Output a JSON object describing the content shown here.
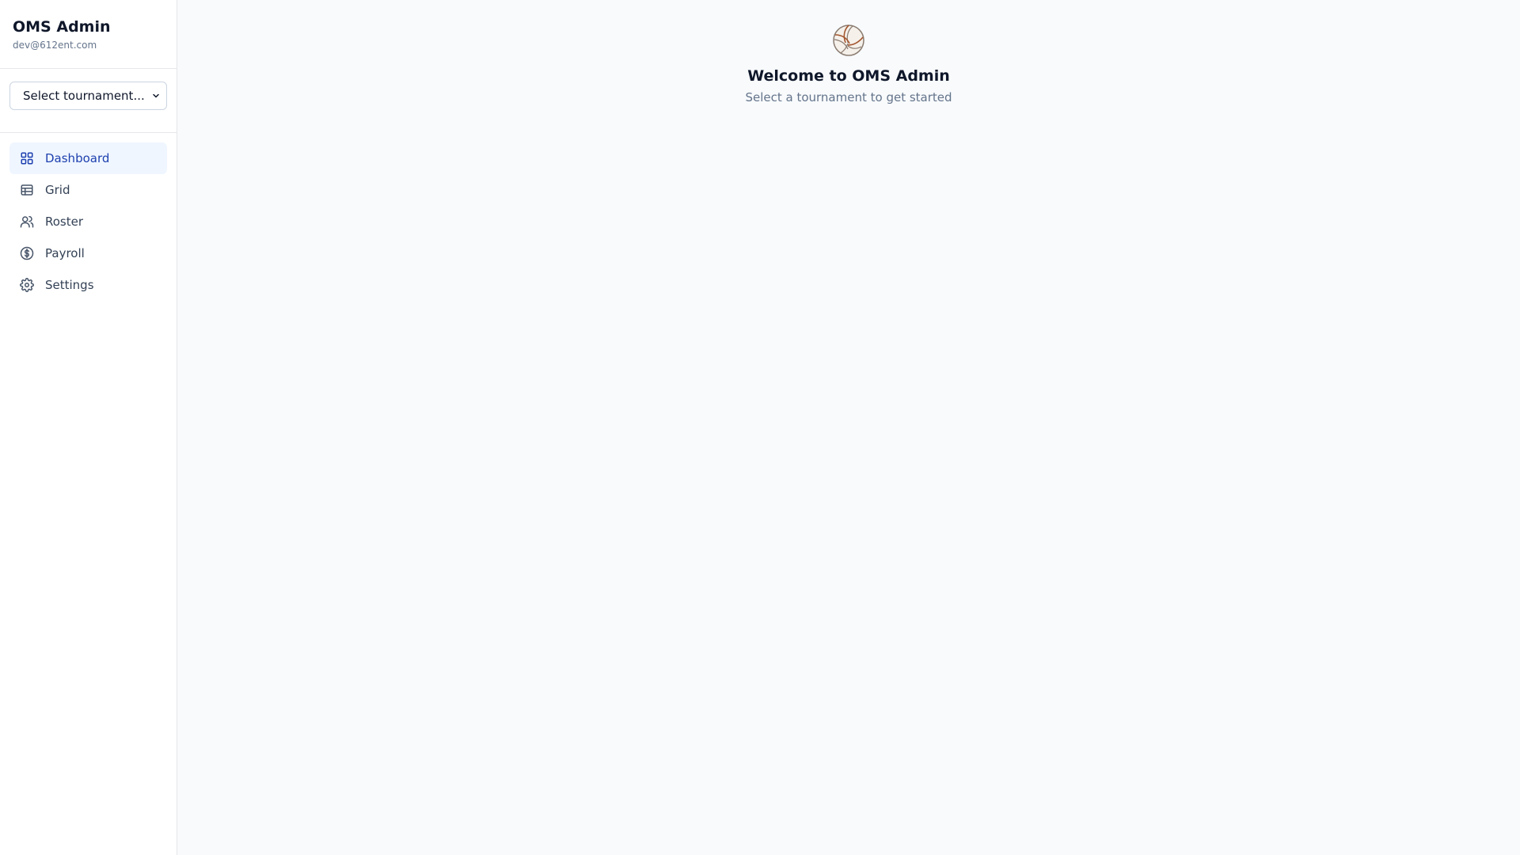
{
  "sidebar": {
    "app_title": "OMS Admin",
    "user_email": "dev@612ent.com",
    "tournament_select": {
      "selected": "Select tournament..."
    },
    "nav": [
      {
        "label": "Dashboard",
        "icon": "dashboard-icon",
        "active": true
      },
      {
        "label": "Grid",
        "icon": "table-icon",
        "active": false
      },
      {
        "label": "Roster",
        "icon": "users-icon",
        "active": false
      },
      {
        "label": "Payroll",
        "icon": "dollar-circle-icon",
        "active": false
      },
      {
        "label": "Settings",
        "icon": "gear-icon",
        "active": false
      }
    ]
  },
  "main": {
    "icon": "volleyball-icon",
    "title": "Welcome to OMS Admin",
    "subtitle": "Select a tournament to get started"
  },
  "colors": {
    "accent": "#1e40af",
    "active_bg": "#eff6ff",
    "page_bg": "#f8fafc",
    "muted_text": "#64748b"
  }
}
